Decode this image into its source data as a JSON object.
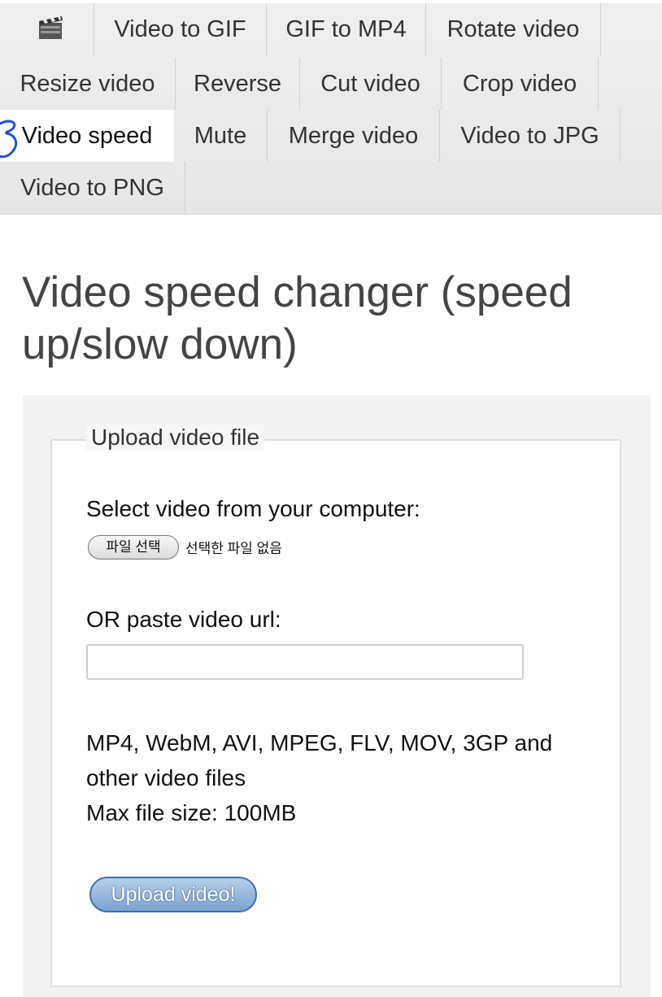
{
  "nav": {
    "logo_icon": "clapperboard-icon",
    "items": [
      {
        "label": "Video to GIF"
      },
      {
        "label": "GIF to MP4"
      },
      {
        "label": "Rotate video"
      },
      {
        "label": "Resize video"
      },
      {
        "label": "Reverse"
      },
      {
        "label": "Cut video"
      },
      {
        "label": "Crop video"
      },
      {
        "label": "Video speed",
        "active": true
      },
      {
        "label": "Mute"
      },
      {
        "label": "Merge video"
      },
      {
        "label": "Video to JPG"
      },
      {
        "label": "Video to PNG"
      }
    ]
  },
  "page": {
    "title": "Video speed changer (speed up/slow down)"
  },
  "upload": {
    "legend": "Upload video file",
    "select_label": "Select video from your computer:",
    "file_button": "파일 선택",
    "file_status": "선택한 파일 없음",
    "url_label": "OR paste video url:",
    "url_value": "",
    "formats_text": "MP4, WebM, AVI, MPEG, FLV, MOV, 3GP and other video files",
    "max_size": "Max file size: 100MB",
    "submit_label": "Upload video!"
  },
  "colors": {
    "nav_bg": "#ececec",
    "active_tab_bg": "#ffffff",
    "button_blue": "#7aa3d1",
    "scribble": "#1f4fd6"
  }
}
